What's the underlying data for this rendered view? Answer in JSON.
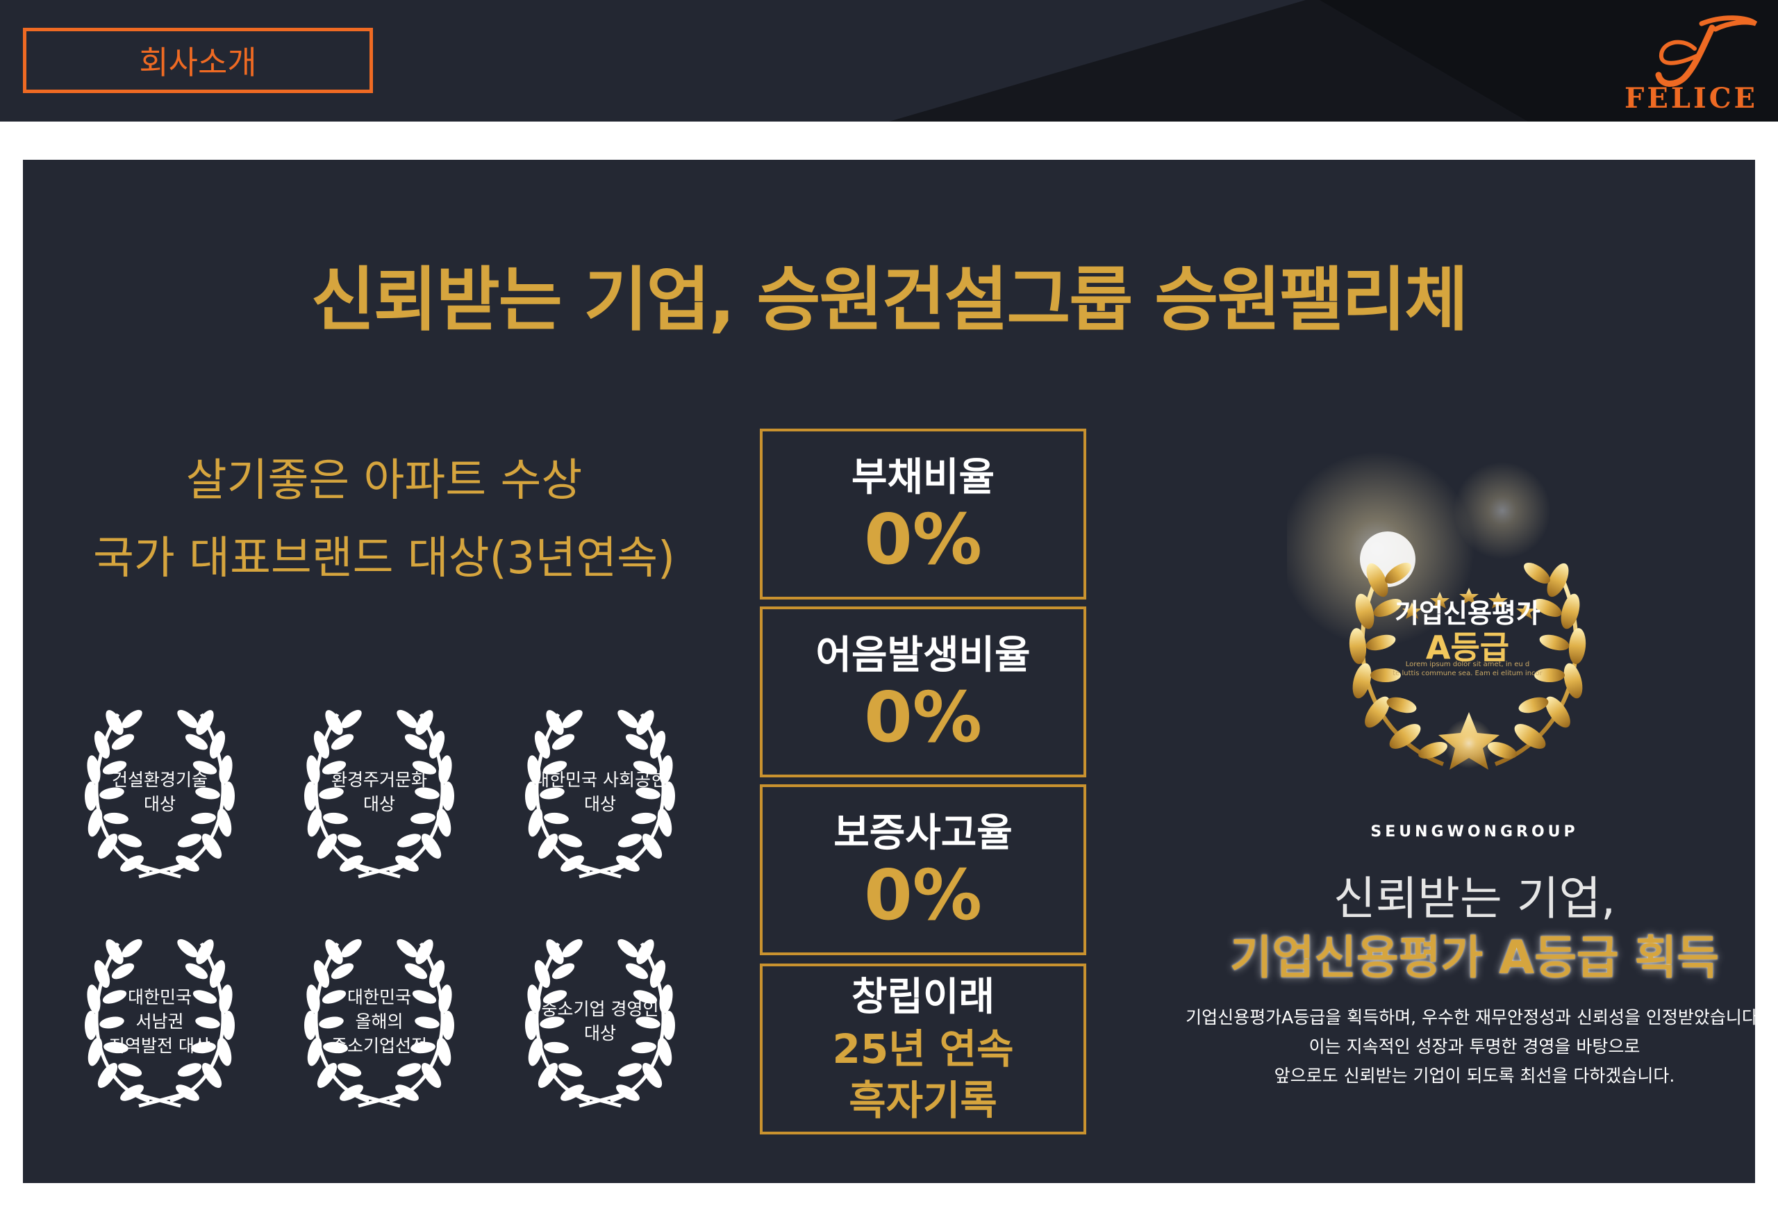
{
  "header": {
    "tab_label": "회사소개",
    "logo_text": "FELICE",
    "accent_color": "#ef6a23"
  },
  "main": {
    "headline": "신뢰받는 기업, 승원건설그룹 승원팰리체",
    "left_titles": [
      "살기좋은 아파트 수상",
      "국가 대표브랜드 대상(3년연속)"
    ],
    "awards": [
      {
        "lines": [
          "건설환경기술",
          "대상"
        ]
      },
      {
        "lines": [
          "환경주거문화",
          "대상"
        ]
      },
      {
        "lines": [
          "대한민국 사회공헌",
          "대상"
        ]
      },
      {
        "lines": [
          "대한민국",
          "서남권",
          "지역발전 대상"
        ]
      },
      {
        "lines": [
          "대한민국",
          "올해의",
          "중소기업선정"
        ]
      },
      {
        "lines": [
          "중소기업 경영인",
          "대상"
        ]
      }
    ],
    "stats": [
      {
        "label": "부채비율",
        "value": "0%"
      },
      {
        "label": "어음발생비율",
        "value": "0%"
      },
      {
        "label": "보증사고율",
        "value": "0%"
      },
      {
        "label": "창립이래",
        "value_lines": [
          "25년 연속",
          "흑자기록"
        ]
      }
    ],
    "credit_award": {
      "line1": "기업신용평가",
      "line2": "A등급",
      "lorem1": "Lorem ipsum dolor sit amet, in eu d",
      "lorem2": "te luttis commune sea. Eam ei elitum incor"
    },
    "group_label": "SEUNGWONGROUP",
    "right_heading1": "신뢰받는 기업,",
    "right_heading2": "기업신용평가 A등급 획득",
    "right_body": [
      "기업신용평가A등급을 획득하며, 우수한 재무안정성과 신뢰성을 인정받았습니다.",
      "이는 지속적인 성장과 투명한 경영을 바탕으로",
      "앞으로도 신뢰받는 기업이 되도록 최선을 다하겠습니다."
    ],
    "gold_color": "#d6a53e",
    "panel_color": "#242833"
  }
}
